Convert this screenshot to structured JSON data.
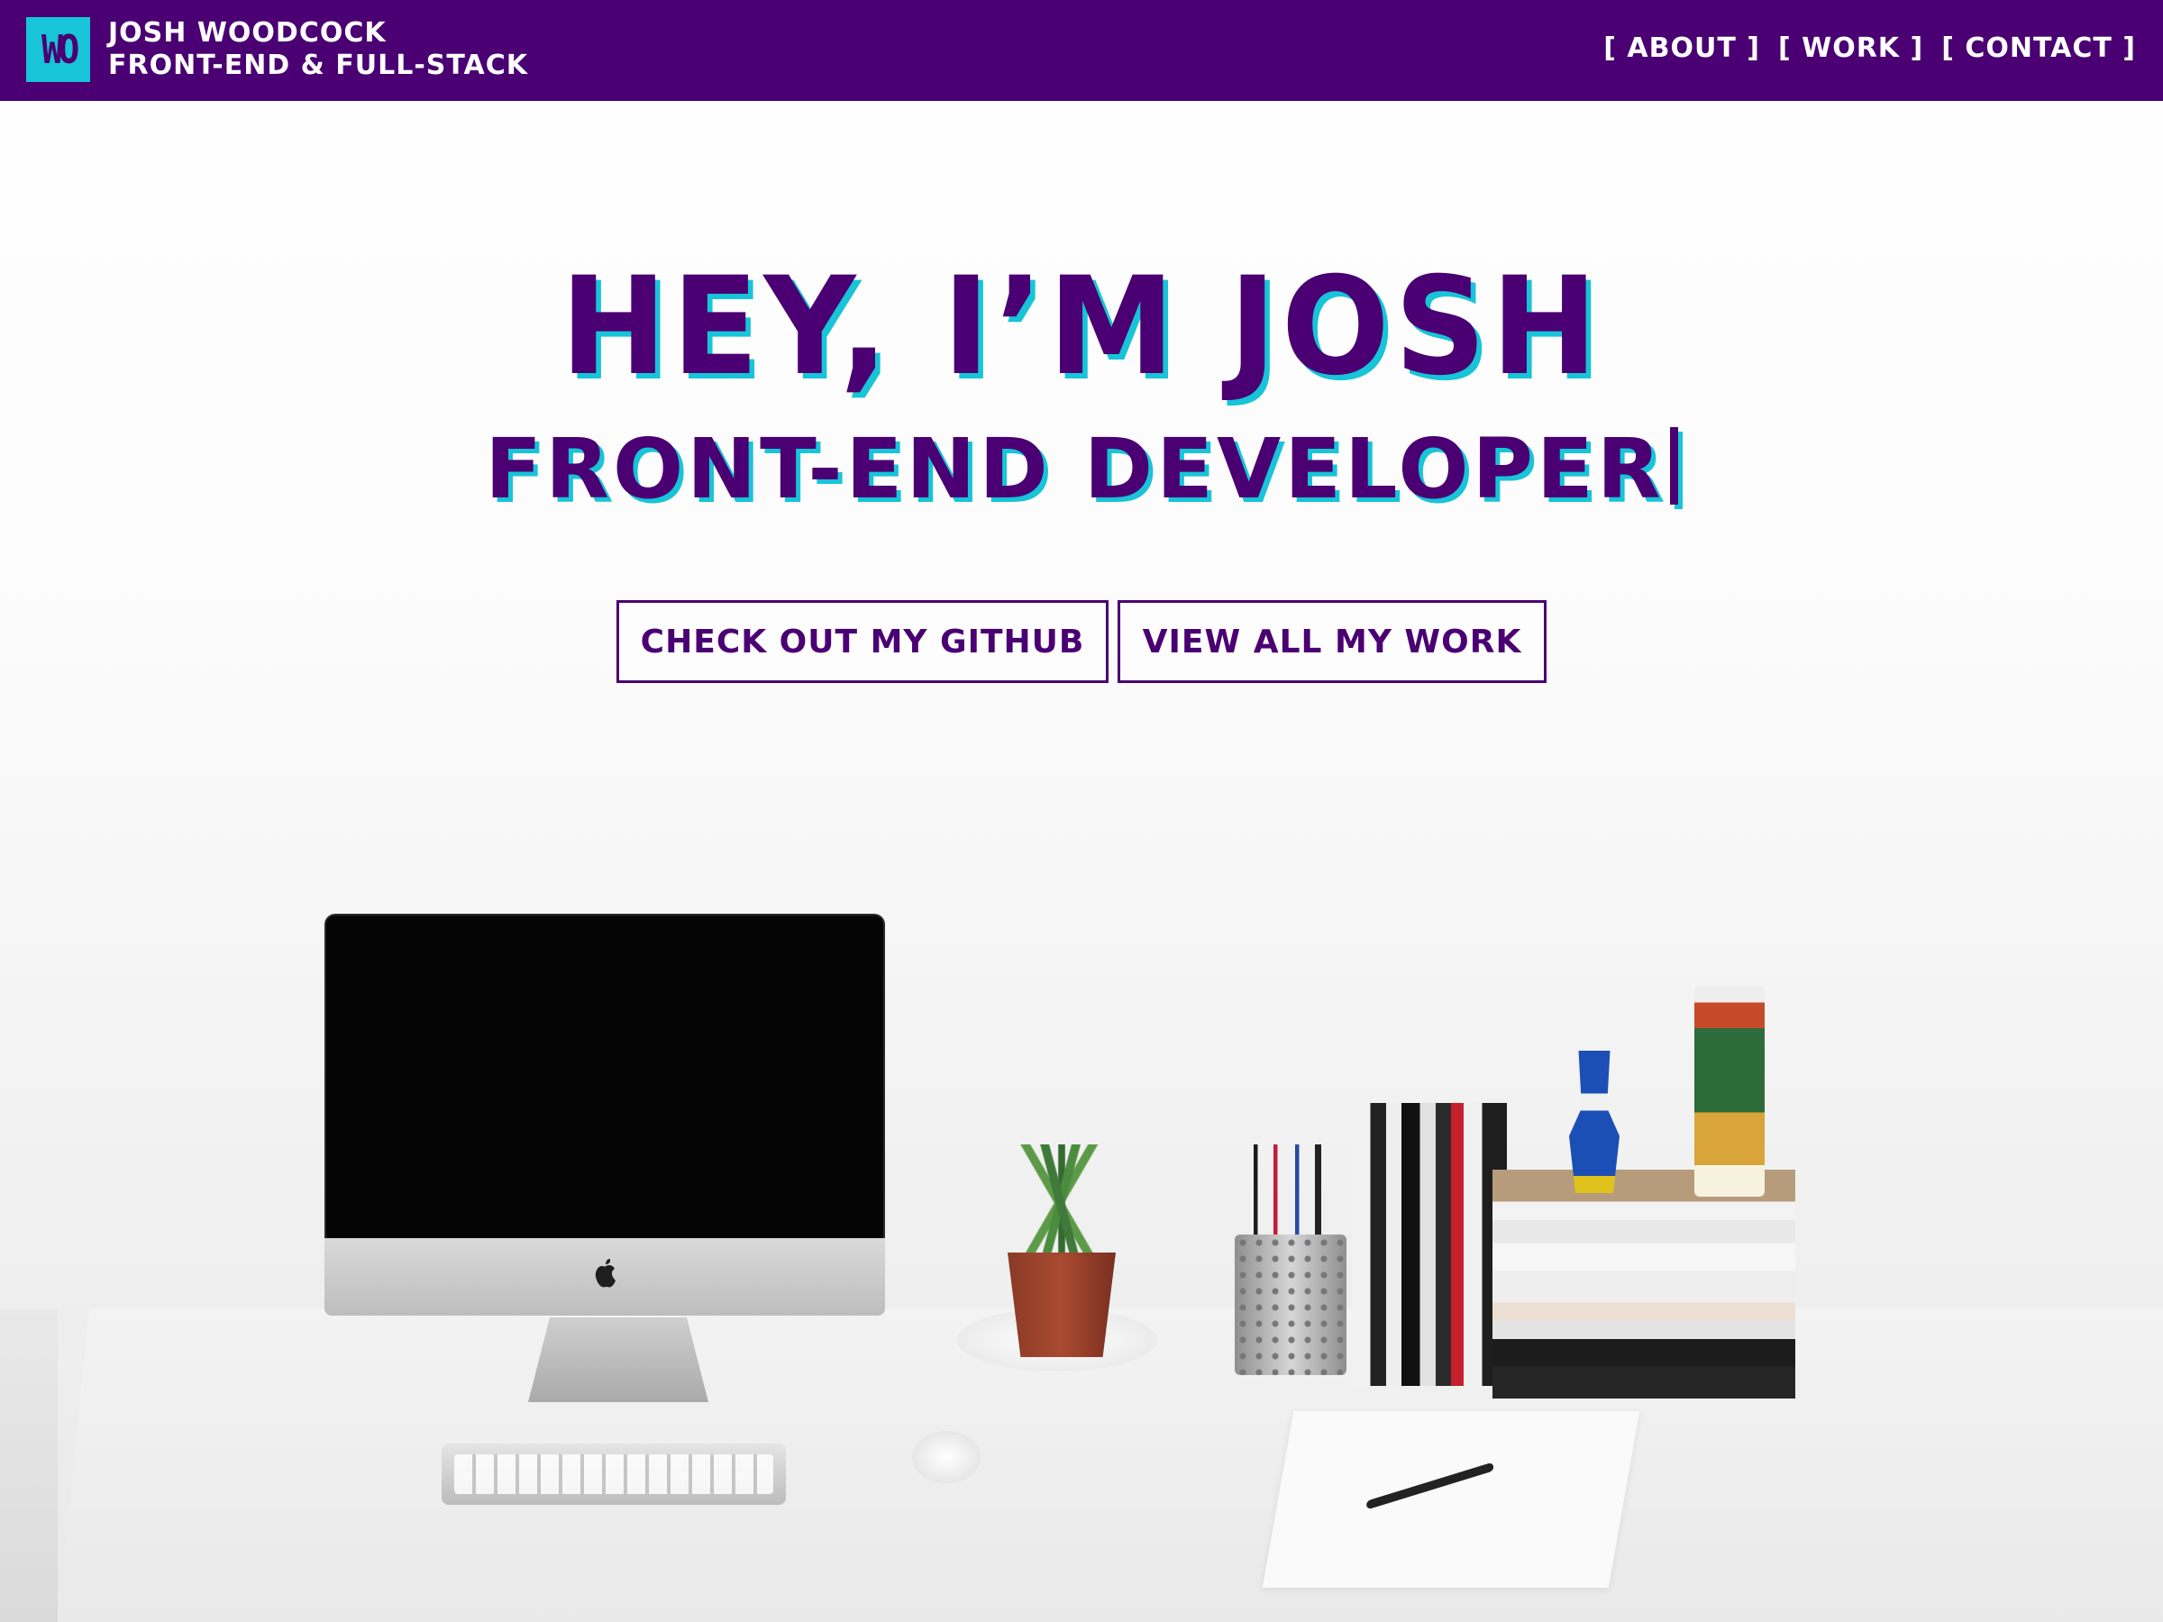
{
  "colors": {
    "primary_purple": "#4a0072",
    "accent_cyan": "#17c4d8",
    "header_text": "#ffffff"
  },
  "header": {
    "logo_text": "WO",
    "name": "JOSH WOODCOCK",
    "tagline": "FRONT-END & FULL-STACK",
    "nav": [
      {
        "label": "[ ABOUT ]"
      },
      {
        "label": "[ WORK ]"
      },
      {
        "label": "[ CONTACT ]"
      }
    ]
  },
  "hero": {
    "title": "HEY, I’M JOSH",
    "subtitle": "FRONT-END DEVELOPER",
    "buttons": {
      "github": "CHECK OUT MY GITHUB",
      "work": "VIEW ALL MY WORK"
    }
  },
  "icons": {
    "logo": "logo-mark-icon",
    "apple": "apple-logo-icon"
  }
}
